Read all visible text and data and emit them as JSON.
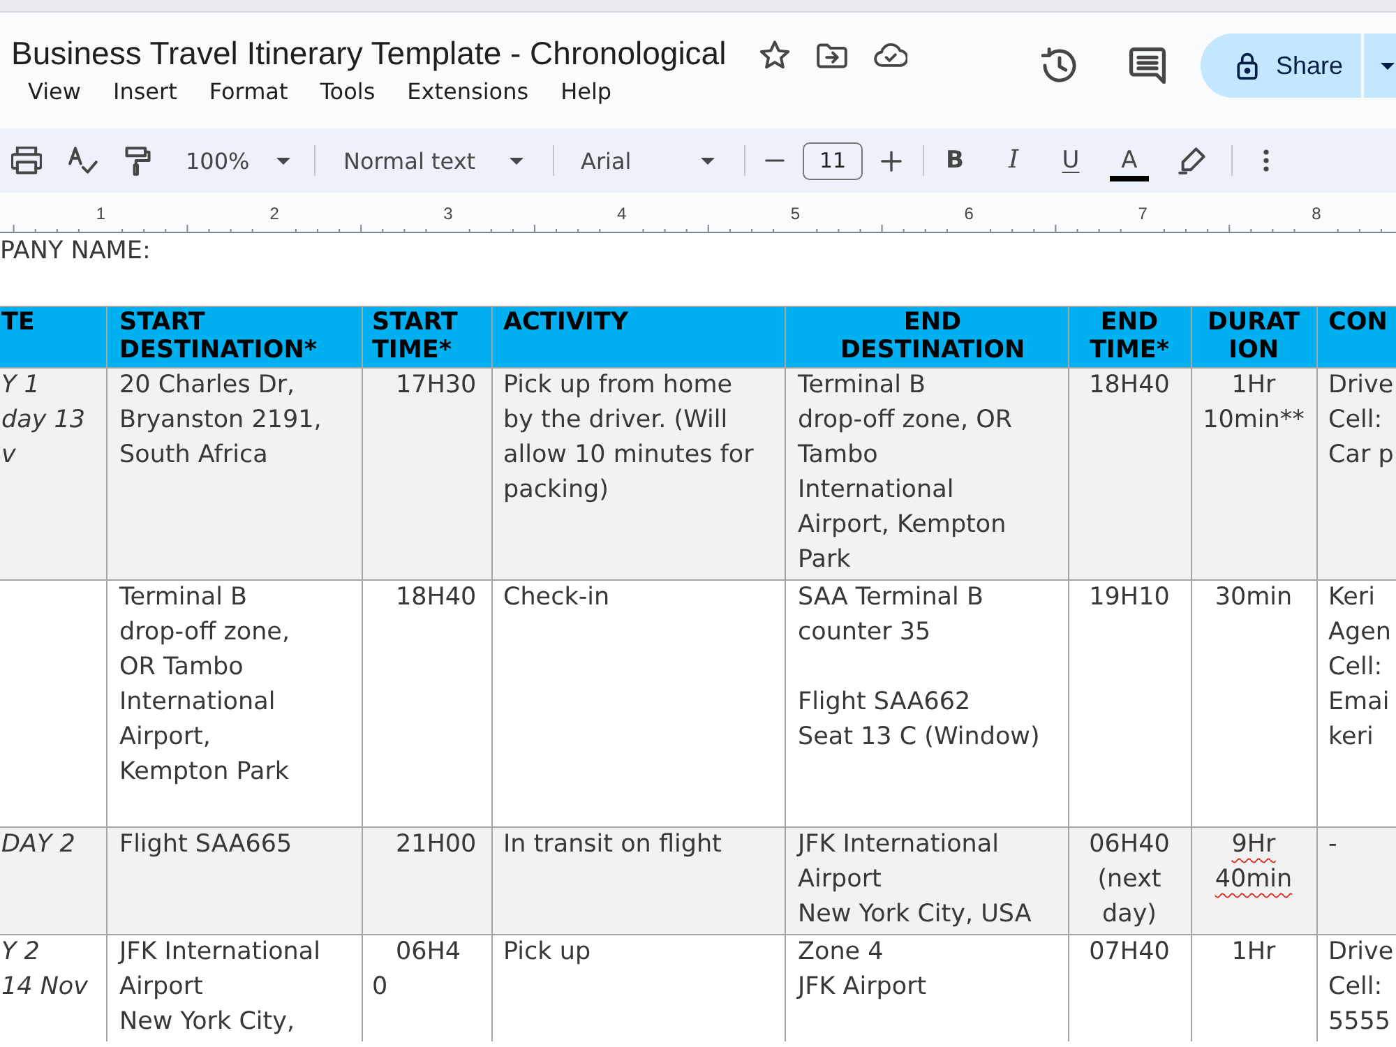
{
  "window": {
    "title": "Business Travel Itinerary Template - Chronological"
  },
  "menu": [
    "View",
    "Insert",
    "Format",
    "Tools",
    "Extensions",
    "Help"
  ],
  "share_button": {
    "label": "Share"
  },
  "toolbar": {
    "zoom": "100%",
    "paragraph_style": "Normal text",
    "font": "Arial",
    "font_size": "11",
    "format_buttons": [
      {
        "kind": "bold",
        "label": "B"
      },
      {
        "kind": "italic",
        "label": "I"
      },
      {
        "kind": "underline",
        "label": "U"
      },
      {
        "kind": "text_color",
        "label": "A"
      }
    ]
  },
  "ruler": {
    "labels": [
      "1",
      "2",
      "3",
      "4",
      "5",
      "6",
      "7",
      "8"
    ]
  },
  "document": {
    "company_label": "PANY NAME:",
    "table": {
      "columns": [
        "TE",
        "START\nDESTINATION*",
        "START\nTIME*",
        "ACTIVITY",
        "END\nDESTINATION",
        "END\nTIME*",
        "DURAT\nION",
        "CON"
      ],
      "rows": [
        {
          "shaded": true,
          "duration_spell_error": false,
          "cells": [
            "Y 1\nday 13\nv",
            "20 Charles Dr,\nBryanston 2191,\nSouth Africa",
            "17H30",
            "Pick up from home\nby the driver. (Will\nallow 10 minutes for\npacking)",
            "Terminal B\ndrop-off zone, OR\nTambo\nInternational\nAirport, Kempton\nPark",
            "18H40",
            "1Hr\n10min**",
            "Drive\nCell:\nCar p"
          ]
        },
        {
          "shaded": false,
          "duration_spell_error": false,
          "cells": [
            null,
            "Terminal B\ndrop-off zone,\nOR Tambo\nInternational\nAirport,\nKempton Park",
            "18H40",
            "Check-in",
            "SAA Terminal B\ncounter 35\n\nFlight SAA662\nSeat 13 C (Window)",
            "19H10",
            "30min",
            "Keri\nAgen\nCell:\nEmai\nkeri"
          ]
        },
        {
          "shaded": true,
          "duration_spell_error": true,
          "cells": [
            "DAY 2",
            "Flight SAA665",
            "21H00",
            "In transit on flight",
            "JFK International\nAirport\nNew York City, USA",
            "06H40\n(next\nday)",
            "9Hr\n40min",
            "-"
          ]
        },
        {
          "shaded": false,
          "duration_spell_error": false,
          "cells": [
            "Y 2\n14 Nov",
            "JFK International\nAirport\nNew York City,",
            "06H4\n0",
            "Pick up",
            "Zone 4\nJFK Airport",
            "07H40",
            "1Hr",
            "Drive\nCell:\n5555"
          ]
        }
      ]
    }
  }
}
